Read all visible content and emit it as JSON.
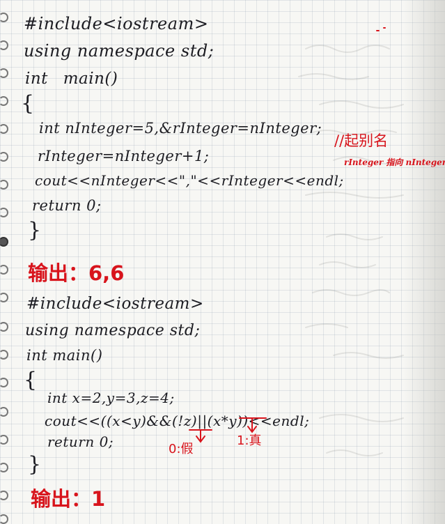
{
  "colors": {
    "ink": "#1c1c22",
    "annotation": "#d8141c",
    "paper": "#f7f7f4"
  },
  "program1": {
    "include": "#include<iostream>",
    "using": "using namespace std;",
    "main_sig": "int main()",
    "open_brace": "{",
    "decl": "int nInteger=5,&rInteger=nInteger;",
    "decl_note": "//起别名",
    "sub_note": "rInteger 指向 nInteger",
    "assign": "rInteger=nInteger+1;",
    "cout": "cout<<nInteger<<\",\"<<rInteger<<endl;",
    "ret": "return 0;",
    "close_brace": "}",
    "output": "输出：6,6"
  },
  "program2": {
    "include": "#include<iostream>",
    "using": "using namespace std;",
    "main_sig": "int main()",
    "open_brace": "{",
    "decl": "int x=2,y=3,z=4;",
    "cout": "cout<<((x<y)&&(!z)||(x*y))<<endl;",
    "ret": "return 0;",
    "false_note": "0:假",
    "true_note": "1:真",
    "close_brace": "}",
    "output": "输出：1"
  }
}
